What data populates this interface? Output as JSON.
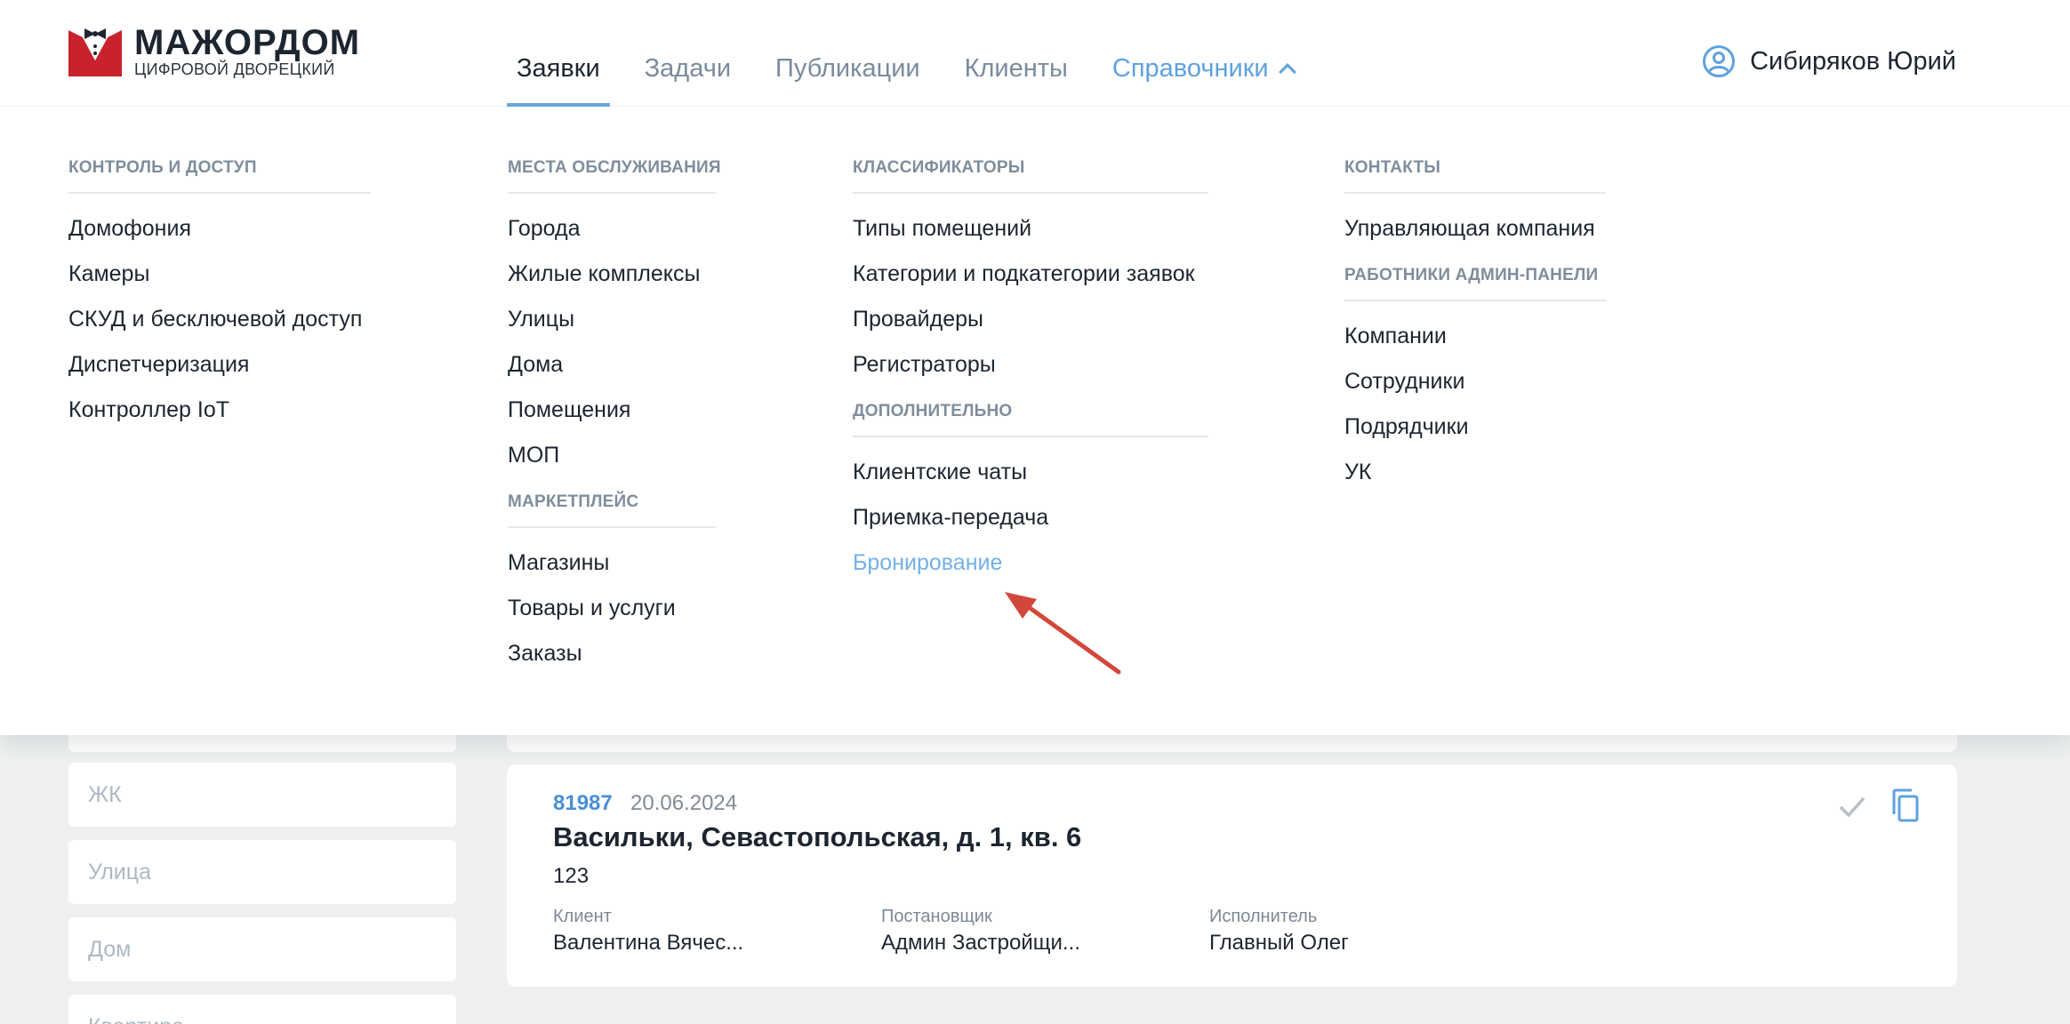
{
  "logo": {
    "title": "МАЖОРДОМ",
    "subtitle": "ЦИФРОВОЙ ДВОРЕЦКИЙ",
    "brand_red": "#c8232c"
  },
  "nav": {
    "tabs": [
      {
        "label": "Заявки",
        "state": "active"
      },
      {
        "label": "Задачи",
        "state": ""
      },
      {
        "label": "Публикации",
        "state": ""
      },
      {
        "label": "Клиенты",
        "state": ""
      },
      {
        "label": "Справочники",
        "state": "open"
      }
    ]
  },
  "user": {
    "name": "Сибиряков Юрий",
    "icon": "user-circle-icon"
  },
  "menu": {
    "col1": {
      "title": "КОНТРОЛЬ И ДОСТУП",
      "items": [
        "Домофония",
        "Камеры",
        "СКУД и бесключевой доступ",
        "Диспетчеризация",
        "Контроллер IoT"
      ]
    },
    "col2": {
      "title": "МЕСТА ОБСЛУЖИВАНИЯ",
      "items": [
        "Города",
        "Жилые комплексы",
        "Улицы",
        "Дома",
        "Помещения",
        "МОП"
      ],
      "title2": "МАРКЕТПЛЕЙС",
      "items2": [
        "Магазины",
        "Товары и услуги",
        "Заказы"
      ]
    },
    "col3": {
      "title": "КЛАССИФИКАТОРЫ",
      "items": [
        "Типы помещений",
        "Категории и подкатегории заявок",
        "Провайдеры",
        "Регистраторы"
      ],
      "title2": "ДОПОЛНИТЕЛЬНО",
      "items2": [
        "Клиентские чаты",
        "Приемка-передача",
        "Бронирование"
      ]
    },
    "col4": {
      "title": "КОНТАКТЫ",
      "items": [
        "Управляющая компания"
      ],
      "title2": "РАБОТНИКИ АДМИН-ПАНЕЛИ",
      "items2": [
        "Компании",
        "Сотрудники",
        "Подрядчики",
        "УК"
      ]
    }
  },
  "filters": {
    "complex_placeholder": "ЖК",
    "street_placeholder": "Улица",
    "house_placeholder": "Дом",
    "flat_placeholder": "Квартира"
  },
  "card": {
    "number": "81987",
    "date": "20.06.2024",
    "address": "Васильки, Севастопольская, д. 1, кв. 6",
    "description": "123",
    "client_label": "Клиент",
    "client_value": "Валентина Вячес...",
    "creator_label": "Постановщик",
    "creator_value": "Админ Застройщи...",
    "executor_label": "Исполнитель",
    "executor_value": "Главный Олег"
  },
  "annotation_color": "#d2473b",
  "accent_color": "#5fa1df"
}
